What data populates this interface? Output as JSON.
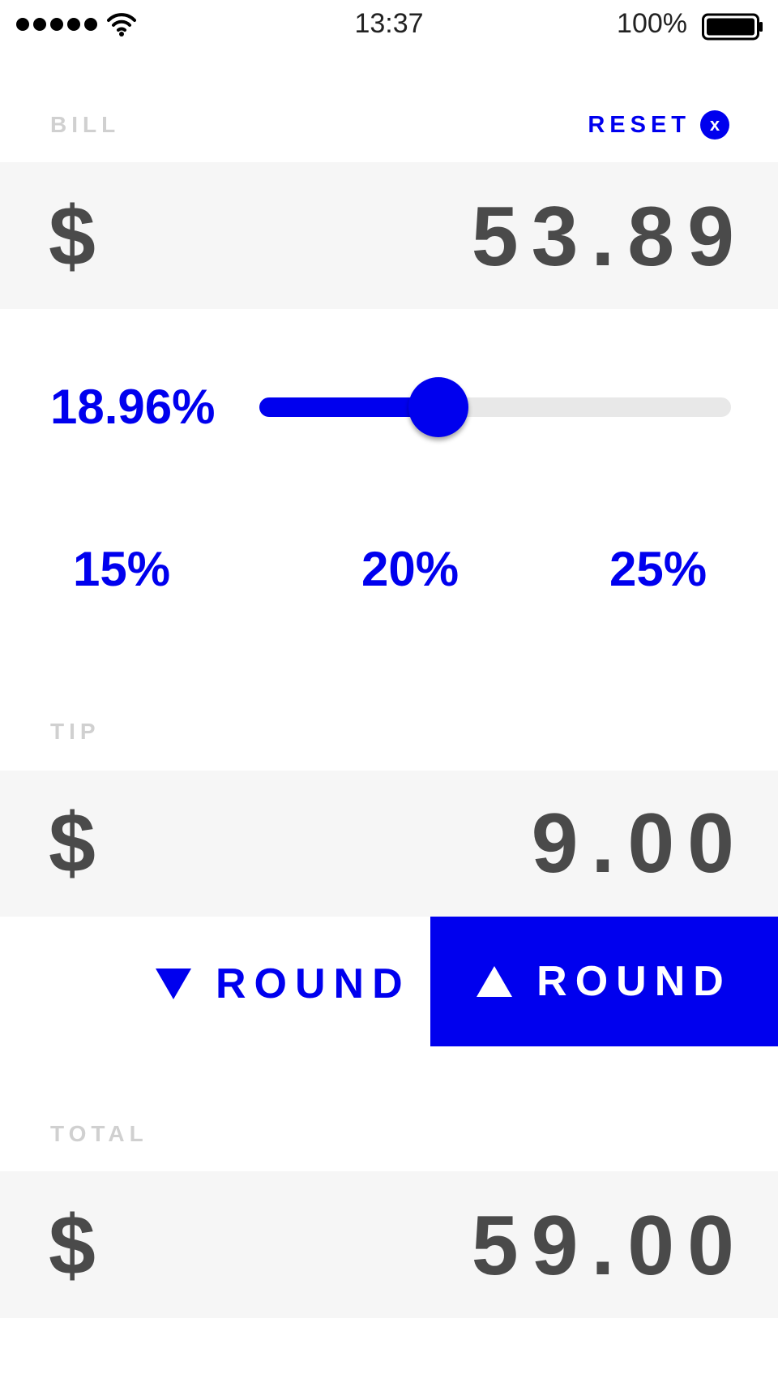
{
  "status_bar": {
    "time": "13:37",
    "battery_percent": "100%",
    "signal_icon": "signal-dots-icon",
    "wifi_icon": "wifi-icon",
    "battery_icon": "battery-icon"
  },
  "bill": {
    "label": "BILL",
    "reset_label": "RESET",
    "reset_icon": "x",
    "currency": "$",
    "amount": "53.89"
  },
  "tip_slider": {
    "percent_label": "18.96%",
    "value_fraction": 0.38
  },
  "presets": [
    "15%",
    "20%",
    "25%"
  ],
  "tip": {
    "label": "TIP",
    "currency": "$",
    "amount": "9.00"
  },
  "rounding": {
    "round_down_label": "ROUND",
    "round_down_icon": "triangle-down-icon",
    "round_up_label": "ROUND",
    "round_up_icon": "triangle-up-icon",
    "selected": "up"
  },
  "total": {
    "label": "TOTAL",
    "currency": "$",
    "amount": "59.00"
  },
  "colors": {
    "accent": "#0000ee",
    "text_dark": "#4a4a4a",
    "label_gray": "#d0d0d0",
    "row_bg": "#f6f6f6"
  }
}
